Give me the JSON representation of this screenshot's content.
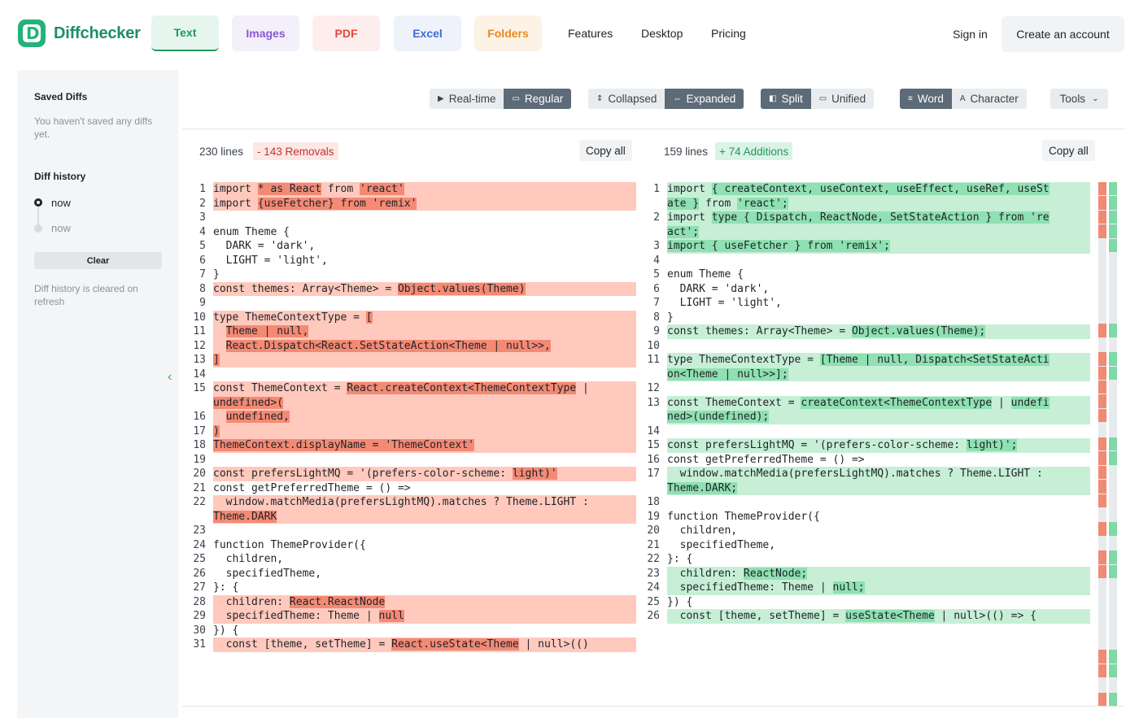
{
  "header": {
    "logo_text": "Diffchecker",
    "tabs": [
      {
        "label": "Text",
        "bg": "#e6f6ee",
        "color": "#1d9a5c",
        "active": true
      },
      {
        "label": "Images",
        "bg": "#f3effb",
        "color": "#8a5ad1"
      },
      {
        "label": "PDF",
        "bg": "#fdeeed",
        "color": "#e0483a"
      },
      {
        "label": "Excel",
        "bg": "#eef2fb",
        "color": "#3e6bd6"
      },
      {
        "label": "Folders",
        "bg": "#fdf2e6",
        "color": "#e88a1d"
      }
    ],
    "links": [
      "Features",
      "Desktop",
      "Pricing"
    ],
    "sign_in": "Sign in",
    "create_account": "Create an account"
  },
  "sidebar": {
    "saved_title": "Saved Diffs",
    "saved_empty": "You haven't saved any diffs yet.",
    "history_title": "Diff history",
    "history_items": [
      "now",
      "now"
    ],
    "clear_label": "Clear",
    "history_note": "Diff history is cleared on refresh"
  },
  "toolbar": {
    "groups": [
      [
        {
          "label": "Real-time",
          "icon": "▶"
        },
        {
          "label": "Regular",
          "icon": "▭",
          "active": true
        }
      ],
      [
        {
          "label": "Collapsed",
          "icon": "⇕"
        },
        {
          "label": "Expanded",
          "icon": "⇔",
          "active": true
        }
      ],
      [
        {
          "label": "Split",
          "icon": "◧",
          "active": true
        },
        {
          "label": "Unified",
          "icon": "▭"
        }
      ],
      [
        {
          "label": "Word",
          "icon": "≡",
          "active": true
        },
        {
          "label": "Character",
          "icon": "A"
        }
      ]
    ],
    "tools_label": "Tools"
  },
  "left": {
    "lines_label": "230 lines",
    "removals_label": "- 143 Removals",
    "copy_label": "Copy all",
    "rows": [
      {
        "n": "1",
        "t": "rem",
        "s": [
          [
            "import ",
            0
          ],
          [
            "* as React",
            1
          ],
          [
            " from ",
            0
          ],
          [
            "'react'",
            1
          ]
        ]
      },
      {
        "n": "",
        "t": "rem",
        "s": [
          [
            "",
            0
          ]
        ]
      },
      {
        "n": "2",
        "t": "rem",
        "s": [
          [
            "import ",
            0
          ],
          [
            "{useFetcher} from 'remix'",
            1
          ]
        ]
      },
      {
        "n": "",
        "t": "rem",
        "s": [
          [
            "",
            0
          ]
        ]
      },
      {
        "n": "",
        "t": "pad",
        "s": [
          [
            "",
            0
          ]
        ]
      },
      {
        "n": "3",
        "t": "",
        "s": [
          [
            "",
            0
          ]
        ]
      },
      {
        "n": "4",
        "t": "",
        "s": [
          [
            "enum Theme {",
            0
          ]
        ]
      },
      {
        "n": "5",
        "t": "",
        "s": [
          [
            "  DARK = 'dark',",
            0
          ]
        ]
      },
      {
        "n": "6",
        "t": "",
        "s": [
          [
            "  LIGHT = 'light',",
            0
          ]
        ]
      },
      {
        "n": "7",
        "t": "",
        "s": [
          [
            "}",
            0
          ]
        ]
      },
      {
        "n": "8",
        "t": "rem",
        "s": [
          [
            "const themes: Array<Theme> = ",
            0
          ],
          [
            "Object.values(Theme)",
            1
          ]
        ]
      },
      {
        "n": "9",
        "t": "",
        "s": [
          [
            "",
            0
          ]
        ]
      },
      {
        "n": "10",
        "t": "rem",
        "s": [
          [
            "type ThemeContextType = ",
            0
          ],
          [
            "[",
            1
          ]
        ]
      },
      {
        "n": "",
        "t": "rem",
        "s": [
          [
            "",
            0
          ]
        ]
      },
      {
        "n": "11",
        "t": "rem",
        "s": [
          [
            "  ",
            0
          ],
          [
            "Theme | null,",
            1
          ]
        ]
      },
      {
        "n": "12",
        "t": "rem",
        "s": [
          [
            "  ",
            0
          ],
          [
            "React.Dispatch<React.SetStateAction<Theme | null>>,",
            1
          ]
        ]
      },
      {
        "n": "13",
        "t": "rem",
        "s": [
          [
            "]",
            1
          ]
        ]
      },
      {
        "n": "14",
        "t": "",
        "s": [
          [
            "",
            0
          ]
        ]
      },
      {
        "n": "15",
        "t": "rem",
        "s": [
          [
            "const ThemeContext = ",
            0
          ],
          [
            "React.createContext<ThemeContextType",
            1
          ],
          [
            " |",
            0
          ]
        ]
      },
      {
        "n": "",
        "t": "rem",
        "s": [
          [
            "undefined>(",
            1
          ]
        ]
      },
      {
        "n": "16",
        "t": "rem",
        "s": [
          [
            "  ",
            0
          ],
          [
            "undefined,",
            1
          ]
        ]
      },
      {
        "n": "17",
        "t": "rem",
        "s": [
          [
            ")",
            1
          ]
        ]
      },
      {
        "n": "18",
        "t": "rem",
        "s": [
          [
            "ThemeContext.displayName = 'ThemeContext'",
            1
          ]
        ]
      },
      {
        "n": "19",
        "t": "",
        "s": [
          [
            "",
            0
          ]
        ]
      },
      {
        "n": "20",
        "t": "rem",
        "s": [
          [
            "const prefersLightMQ = '(prefers-color-scheme: ",
            0
          ],
          [
            "light)'",
            1
          ]
        ]
      },
      {
        "n": "21",
        "t": "",
        "s": [
          [
            "const getPreferredTheme = () =>",
            0
          ]
        ]
      },
      {
        "n": "22",
        "t": "rem",
        "s": [
          [
            "  window.matchMedia(prefersLightMQ).matches ? Theme.LIGHT :",
            0
          ]
        ]
      },
      {
        "n": "",
        "t": "rem",
        "s": [
          [
            "Theme.DARK",
            1
          ]
        ]
      },
      {
        "n": "23",
        "t": "",
        "s": [
          [
            "",
            0
          ]
        ]
      },
      {
        "n": "24",
        "t": "",
        "s": [
          [
            "function ThemeProvider({",
            0
          ]
        ]
      },
      {
        "n": "25",
        "t": "",
        "s": [
          [
            "  children,",
            0
          ]
        ]
      },
      {
        "n": "26",
        "t": "",
        "s": [
          [
            "  specifiedTheme,",
            0
          ]
        ]
      },
      {
        "n": "27",
        "t": "",
        "s": [
          [
            "}: {",
            0
          ]
        ]
      },
      {
        "n": "28",
        "t": "rem",
        "s": [
          [
            "  children: ",
            0
          ],
          [
            "React.ReactNode",
            1
          ]
        ]
      },
      {
        "n": "29",
        "t": "rem",
        "s": [
          [
            "  specifiedTheme: Theme | ",
            0
          ],
          [
            "null",
            1
          ]
        ]
      },
      {
        "n": "30",
        "t": "",
        "s": [
          [
            "}) {",
            0
          ]
        ]
      },
      {
        "n": "31",
        "t": "rem",
        "s": [
          [
            "  const [theme, setTheme] = ",
            0
          ],
          [
            "React.useState<Theme",
            1
          ],
          [
            " | null>(()",
            0
          ]
        ]
      }
    ]
  },
  "right": {
    "lines_label": "159 lines",
    "additions_label": "+ 74 Additions",
    "copy_label": "Copy all",
    "rows": [
      {
        "n": "1",
        "t": "add",
        "s": [
          [
            "import ",
            0
          ],
          [
            "{ createContext, useContext, useEffect, useRef, useSt",
            1
          ]
        ]
      },
      {
        "n": "",
        "t": "add",
        "s": [
          [
            "ate }",
            1
          ],
          [
            " from ",
            0
          ],
          [
            "'react';",
            1
          ]
        ]
      },
      {
        "n": "2",
        "t": "add",
        "s": [
          [
            "import ",
            0
          ],
          [
            "type { Dispatch, ReactNode, SetStateAction } from 're",
            1
          ]
        ]
      },
      {
        "n": "",
        "t": "add",
        "s": [
          [
            "act';",
            1
          ]
        ]
      },
      {
        "n": "3",
        "t": "add",
        "s": [
          [
            "import { useFetcher } from 'remix';",
            1
          ]
        ]
      },
      {
        "n": "4",
        "t": "",
        "s": [
          [
            "",
            0
          ]
        ]
      },
      {
        "n": "5",
        "t": "",
        "s": [
          [
            "enum Theme {",
            0
          ]
        ]
      },
      {
        "n": "6",
        "t": "",
        "s": [
          [
            "  DARK = 'dark',",
            0
          ]
        ]
      },
      {
        "n": "7",
        "t": "",
        "s": [
          [
            "  LIGHT = 'light',",
            0
          ]
        ]
      },
      {
        "n": "8",
        "t": "",
        "s": [
          [
            "}",
            0
          ]
        ]
      },
      {
        "n": "9",
        "t": "add",
        "s": [
          [
            "const themes: Array<Theme> = ",
            0
          ],
          [
            "Object.values(Theme);",
            1
          ]
        ]
      },
      {
        "n": "10",
        "t": "",
        "s": [
          [
            "",
            0
          ]
        ]
      },
      {
        "n": "11",
        "t": "add",
        "s": [
          [
            "type ThemeContextType = ",
            0
          ],
          [
            "[Theme | null, Dispatch<SetStateActi",
            1
          ]
        ]
      },
      {
        "n": "",
        "t": "add",
        "s": [
          [
            "on<Theme | null>>];",
            1
          ]
        ]
      },
      {
        "n": "",
        "t": "pad",
        "s": [
          [
            "",
            0
          ]
        ]
      },
      {
        "n": "",
        "t": "pad",
        "s": [
          [
            "",
            0
          ]
        ]
      },
      {
        "n": "",
        "t": "pad",
        "s": [
          [
            "",
            0
          ]
        ]
      },
      {
        "n": "12",
        "t": "",
        "s": [
          [
            "",
            0
          ]
        ]
      },
      {
        "n": "13",
        "t": "add",
        "s": [
          [
            "const ThemeContext = ",
            0
          ],
          [
            "createContext<ThemeContextType",
            1
          ],
          [
            " | ",
            0
          ],
          [
            "undefi",
            1
          ]
        ]
      },
      {
        "n": "",
        "t": "add",
        "s": [
          [
            "ned>(undefined);",
            1
          ]
        ]
      },
      {
        "n": "",
        "t": "pad",
        "s": [
          [
            "",
            0
          ]
        ]
      },
      {
        "n": "",
        "t": "pad",
        "s": [
          [
            "",
            0
          ]
        ]
      },
      {
        "n": "",
        "t": "pad",
        "s": [
          [
            "",
            0
          ]
        ]
      },
      {
        "n": "14",
        "t": "",
        "s": [
          [
            "",
            0
          ]
        ]
      },
      {
        "n": "15",
        "t": "add",
        "s": [
          [
            "const prefersLightMQ = '(prefers-color-scheme: ",
            0
          ],
          [
            "light)';",
            1
          ]
        ]
      },
      {
        "n": "16",
        "t": "",
        "s": [
          [
            "const getPreferredTheme = () =>",
            0
          ]
        ]
      },
      {
        "n": "17",
        "t": "add",
        "s": [
          [
            "  window.matchMedia(prefersLightMQ).matches ? Theme.LIGHT :",
            0
          ]
        ]
      },
      {
        "n": "",
        "t": "add",
        "s": [
          [
            "Theme.DARK;",
            1
          ]
        ]
      },
      {
        "n": "18",
        "t": "",
        "s": [
          [
            "",
            0
          ]
        ]
      },
      {
        "n": "19",
        "t": "",
        "s": [
          [
            "function ThemeProvider({",
            0
          ]
        ]
      },
      {
        "n": "20",
        "t": "",
        "s": [
          [
            "  children,",
            0
          ]
        ]
      },
      {
        "n": "21",
        "t": "",
        "s": [
          [
            "  specifiedTheme,",
            0
          ]
        ]
      },
      {
        "n": "22",
        "t": "",
        "s": [
          [
            "}: {",
            0
          ]
        ]
      },
      {
        "n": "23",
        "t": "add",
        "s": [
          [
            "  children: ",
            0
          ],
          [
            "ReactNode;",
            1
          ]
        ]
      },
      {
        "n": "24",
        "t": "add",
        "s": [
          [
            "  specifiedTheme: Theme | ",
            0
          ],
          [
            "null;",
            1
          ]
        ]
      },
      {
        "n": "25",
        "t": "",
        "s": [
          [
            "}) {",
            0
          ]
        ]
      },
      {
        "n": "26",
        "t": "add",
        "s": [
          [
            "  const [theme, setTheme] = ",
            0
          ],
          [
            "useState<Theme",
            1
          ],
          [
            " | null>(() => {",
            0
          ]
        ]
      }
    ]
  },
  "colors": {
    "removed": "#f08a72",
    "added": "#7fd9a6"
  }
}
